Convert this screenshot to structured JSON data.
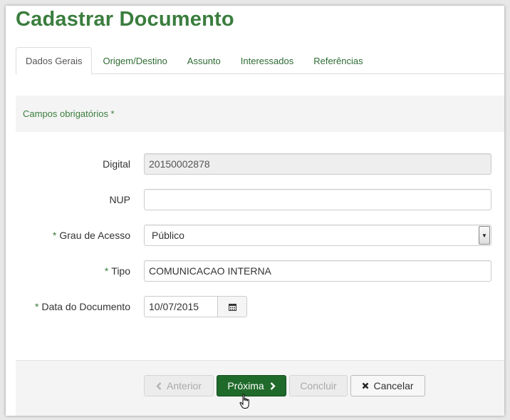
{
  "page": {
    "title": "Cadastrar Documento"
  },
  "tabs": [
    {
      "label": "Dados Gerais",
      "active": true
    },
    {
      "label": "Origem/Destino",
      "active": false
    },
    {
      "label": "Assunto",
      "active": false
    },
    {
      "label": "Interessados",
      "active": false
    },
    {
      "label": "Referências",
      "active": false
    }
  ],
  "required_note": "Campos obrigatórios *",
  "form": {
    "digital": {
      "label": "Digital",
      "value": "20150002878"
    },
    "nup": {
      "label": "NUP",
      "value": ""
    },
    "grau_acesso": {
      "required_mark": "*",
      "label": "Grau de Acesso",
      "value": "Público"
    },
    "tipo": {
      "required_mark": "*",
      "label": "Tipo",
      "value": "COMUNICACAO INTERNA"
    },
    "data_documento": {
      "required_mark": "*",
      "label": "Data do Documento",
      "value": "10/07/2015"
    }
  },
  "buttons": {
    "previous": "Anterior",
    "next": "Próxima",
    "finish": "Concluir",
    "cancel": "Cancelar"
  },
  "colors": {
    "brand_green": "#3a7d3e",
    "primary_button": "#1f6a2a"
  },
  "icons": {
    "previous": "chevron-left-icon",
    "next": "chevron-right-icon",
    "cancel": "close-icon",
    "calendar": "calendar-icon",
    "cursor": "hand-pointer-icon"
  }
}
